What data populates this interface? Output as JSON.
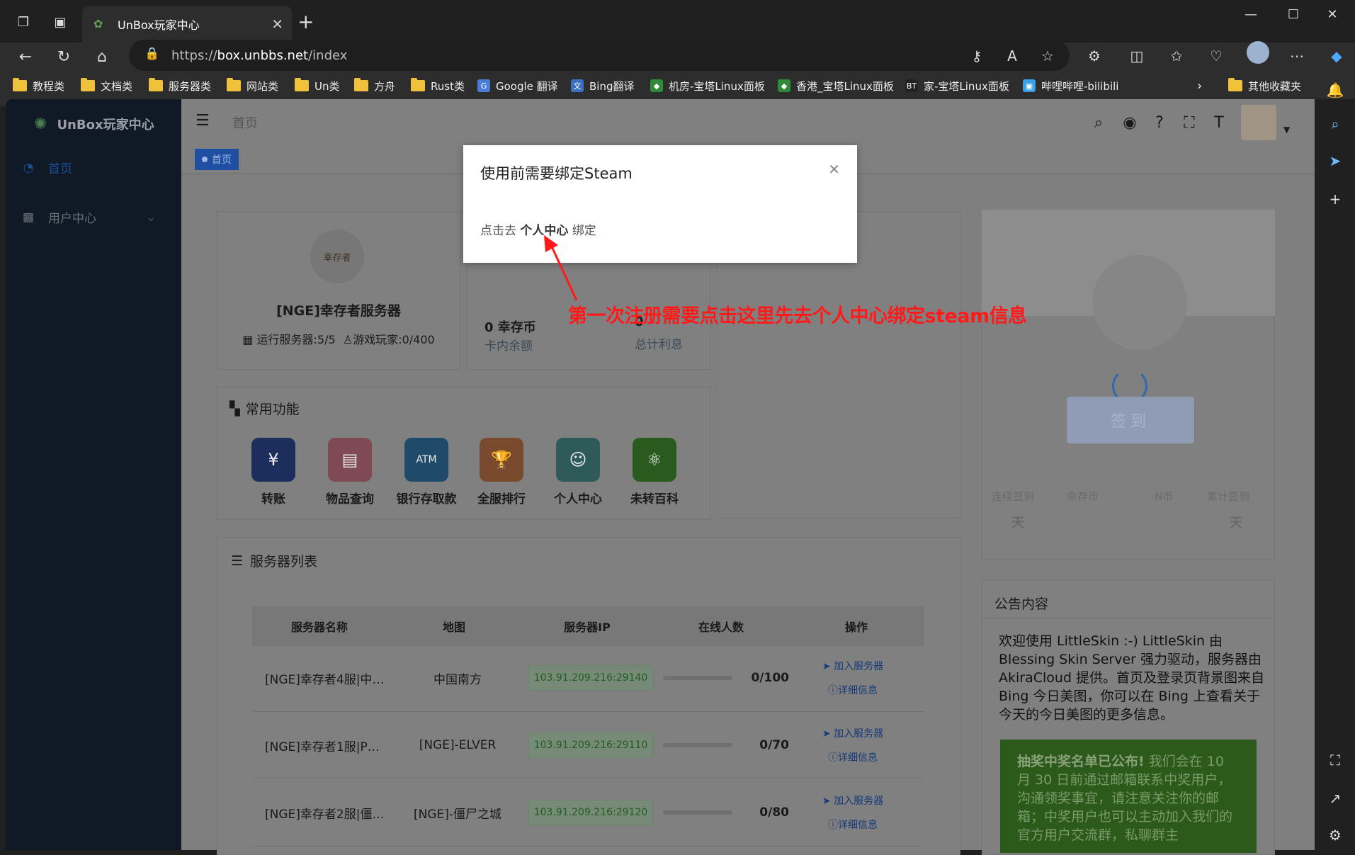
{
  "browser": {
    "tab_title": "UnBox玩家中心",
    "url_prefix": "https://",
    "url_host": "box.unbbs.net",
    "url_path": "/index",
    "bookmarks": [
      {
        "label": "教程类",
        "icon": "folder-icon"
      },
      {
        "label": "文档类",
        "icon": "folder-icon"
      },
      {
        "label": "服务器类",
        "icon": "folder-icon"
      },
      {
        "label": "网站类",
        "icon": "folder-icon"
      },
      {
        "label": "Un类",
        "icon": "folder-icon"
      },
      {
        "label": "方舟",
        "icon": "folder-icon"
      },
      {
        "label": "Rust类",
        "icon": "folder-icon"
      },
      {
        "label": "Google 翻译",
        "icon": "google-translate-icon"
      },
      {
        "label": "Bing翻译",
        "icon": "bing-translate-icon"
      },
      {
        "label": "机房-宝塔Linux面板",
        "icon": "shield-icon"
      },
      {
        "label": "香港_宝塔Linux面板",
        "icon": "shield-icon"
      },
      {
        "label": "家-宝塔Linux面板",
        "icon": "bt-icon"
      },
      {
        "label": "哔哩哔哩-bilibili",
        "icon": "bilibili-icon"
      }
    ],
    "other_bookmarks": "其他收藏夹"
  },
  "sidebar": {
    "logo_text": "UnBox玩家中心",
    "items": [
      {
        "label": "首页",
        "icon": "dashboard-icon",
        "active": true
      },
      {
        "label": "用户中心",
        "icon": "image-icon",
        "active": false
      }
    ]
  },
  "header": {
    "breadcrumb": "首页",
    "tag": "首页"
  },
  "profile_card": {
    "server_name": "[NGE]幸存者服务器",
    "stats": "运行服务器:5/5",
    "players": "游戏玩家:0/400",
    "logo_text": "幸存者"
  },
  "money_card": {
    "coin_value": "0 幸存币",
    "coin_label": "卡内余额",
    "interest_value": "0",
    "interest_label": "总计利息"
  },
  "functions": {
    "title": "常用功能",
    "items": [
      {
        "label": "转账",
        "color": "#1c2e5c",
        "icon": "¥"
      },
      {
        "label": "物品查询",
        "color": "#7f4a54",
        "icon": "▤"
      },
      {
        "label": "银行存取款",
        "color": "#1f4a6a",
        "icon": "ATM"
      },
      {
        "label": "全服排行",
        "color": "#7a4a2e",
        "icon": "🏆"
      },
      {
        "label": "个人中心",
        "color": "#2e5a5a",
        "icon": "☺"
      },
      {
        "label": "未转百科",
        "color": "#2a5a1e",
        "icon": "⚛"
      }
    ]
  },
  "server_list": {
    "title": "服务器列表",
    "headers": [
      "服务器名称",
      "地图",
      "服务器IP",
      "在线人数",
      "操作"
    ],
    "rows": [
      {
        "name": "[NGE]幸存者4服|中…",
        "map": "中国南方",
        "ip": "103.91.209.216:29140",
        "count": "0/100",
        "join": "加入服务器",
        "detail": "详细信息"
      },
      {
        "name": "[NGE]幸存者1服|P…",
        "map": "[NGE]-ELVER",
        "ip": "103.91.209.216:29110",
        "count": "0/70",
        "join": "加入服务器",
        "detail": "详细信息"
      },
      {
        "name": "[NGE]幸存者2服|僵…",
        "map": "[NGE]-僵尸之城",
        "ip": "103.91.209.216:29120",
        "count": "0/80",
        "join": "加入服务器",
        "detail": "详细信息"
      }
    ]
  },
  "checkin_card": {
    "button": "签到",
    "stats": [
      {
        "label": "连续签到",
        "value": "天"
      },
      {
        "label": "幸存币",
        "value": ""
      },
      {
        "label": "N币",
        "value": ""
      },
      {
        "label": "累计签到",
        "value": "天"
      }
    ]
  },
  "announcement": {
    "title": "公告内容",
    "body": "欢迎使用 LittleSkin :-) LittleSkin 由 Blessing Skin Server 强力驱动，服务器由 AkiraCloud 提供。首页及登录页背景图来自 Bing 今日美图，你可以在 Bing 上查看关于今天的今日美图的更多信息。",
    "notice_bold": "抽奖中奖名单已公布!",
    "notice_text": " 我们会在 10 月 30 日前通过邮箱联系中奖用户，沟通领奖事宜，请注意关注你的邮箱；中奖用户也可以主动加入我们的官方用户交流群，私聊群主"
  },
  "modal": {
    "title": "使用前需要绑定Steam",
    "body_prefix": "点击去 ",
    "body_link": "个人中心",
    "body_suffix": " 绑定"
  },
  "annotation": {
    "text": "第一次注册需要点击这里先去个人中心绑定steam信息",
    "color": "#ff1a1a"
  }
}
